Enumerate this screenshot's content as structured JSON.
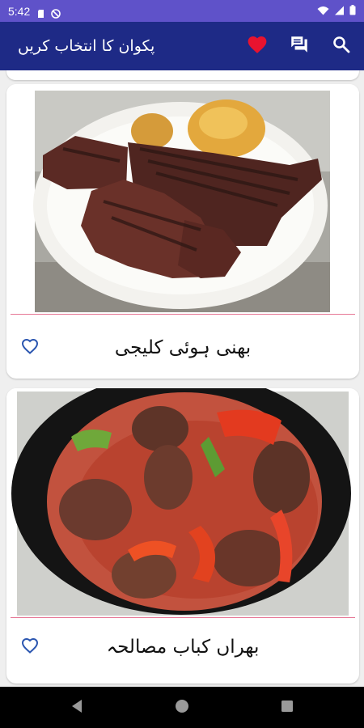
{
  "status_bar": {
    "time": "5:42",
    "left_icons": [
      "sd-card-icon",
      "do-not-disturb-icon"
    ],
    "right_icons": [
      "wifi-icon",
      "signal-icon",
      "battery-icon"
    ]
  },
  "app_bar": {
    "title": "پکوان کا انتخاب کریں",
    "actions": [
      "favorites-heart-icon",
      "chat-icon",
      "search-icon"
    ],
    "background": "#1e2a86",
    "heart_color": "#e8132f"
  },
  "recipes": [
    {
      "title": "بھنی ہوئی کلیجی",
      "favorite": false,
      "image": "grilled liver slices with roasted potatoes on a white plate"
    },
    {
      "title": "بھراں کباب مصالحہ",
      "favorite": false,
      "image": "kabab balls in red tomato pepper gravy in a black bowl"
    }
  ],
  "nav_bar": {
    "buttons": [
      "back-icon",
      "home-icon",
      "recents-icon"
    ]
  },
  "colors": {
    "status_bar": "#5f52c9",
    "divider": "#e67896",
    "fav_outline": "#2b56b0"
  }
}
